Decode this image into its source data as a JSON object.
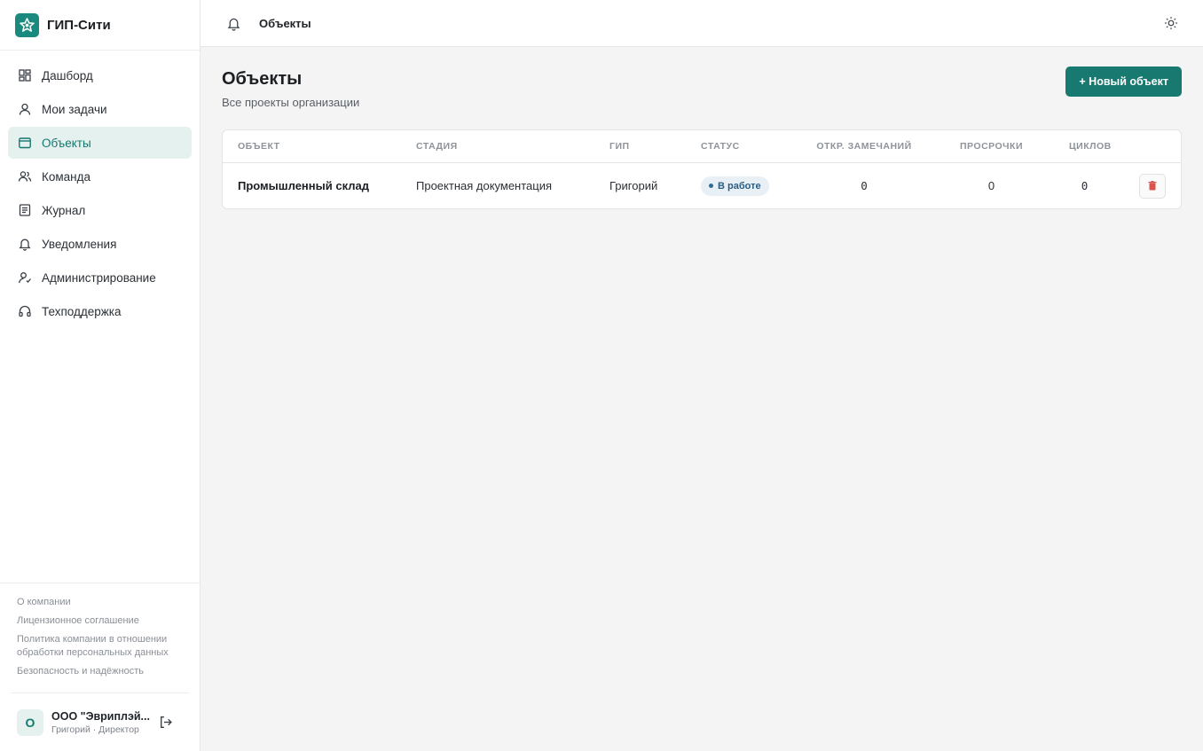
{
  "brand": {
    "name": "ГИП-Сити",
    "icon": "brand-logo-icon",
    "color": "#1a8a7e"
  },
  "nav": {
    "items": [
      {
        "label": "Дашборд",
        "icon": "dashboard-icon"
      },
      {
        "label": "Мои задачи",
        "icon": "user-icon"
      },
      {
        "label": "Объекты",
        "icon": "folder-icon",
        "active": true
      },
      {
        "label": "Команда",
        "icon": "team-icon"
      },
      {
        "label": "Журнал",
        "icon": "journal-icon"
      },
      {
        "label": "Уведомления",
        "icon": "bell-icon"
      },
      {
        "label": "Администрирование",
        "icon": "admin-icon"
      },
      {
        "label": "Техподдержка",
        "icon": "headset-icon"
      }
    ]
  },
  "footer": {
    "links": [
      "О компании",
      "Лицензионное соглашение",
      "Политика компании в отношении обработки персональных данных",
      "Безопасность и надёжность"
    ]
  },
  "user": {
    "avatar": "О",
    "org": "ООО \"Эвриплэй...",
    "role": "Григорий · Директор"
  },
  "topbar": {
    "title": "Объекты"
  },
  "page": {
    "title": "Объекты",
    "subtitle": "Все проекты организации",
    "new_button": "+ Новый объект"
  },
  "table": {
    "headers": [
      "ОБЪЕКТ",
      "СТАДИЯ",
      "ГИП",
      "СТАТУС",
      "ОТКР. ЗАМЕЧАНИЙ",
      "ПРОСРОЧКИ",
      "ЦИКЛОВ"
    ],
    "rows": [
      {
        "object": "Промышленный склад",
        "stage": "Проектная документация",
        "gip": "Григорий",
        "status": "В работе",
        "open_remarks": "0",
        "overdue": "0",
        "cycles": "0"
      }
    ]
  },
  "colors": {
    "accent": "#17796f",
    "active_bg": "#e4f1ef",
    "status_bg": "#e8f0f6",
    "danger": "#d9534f"
  }
}
